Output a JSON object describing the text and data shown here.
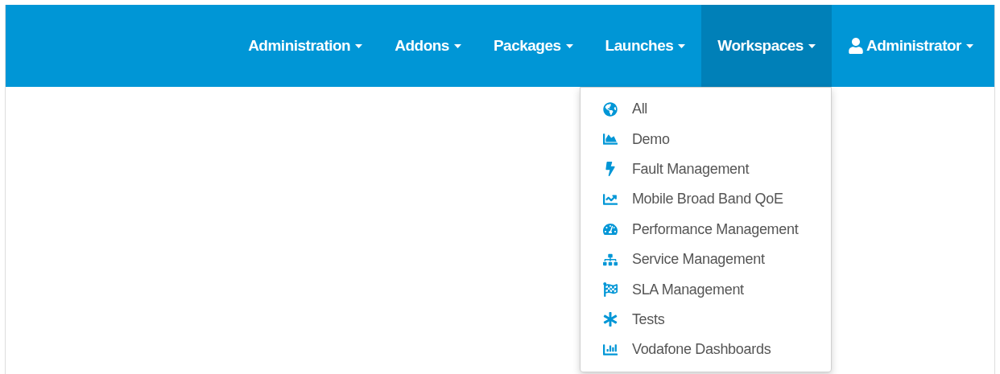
{
  "navbar": {
    "items": [
      {
        "label": "Administration",
        "selected": false
      },
      {
        "label": "Addons",
        "selected": false
      },
      {
        "label": "Packages",
        "selected": false
      },
      {
        "label": "Launches",
        "selected": false
      },
      {
        "label": "Workspaces",
        "selected": true
      },
      {
        "label": "Administrator",
        "selected": false
      }
    ]
  },
  "workspaces_menu": {
    "items": [
      "All",
      "Demo",
      "Fault Management",
      "Mobile Broad Band QoE",
      "Performance Management",
      "Service Management",
      "SLA Management",
      "Tests",
      "Vodafone Dashboards"
    ]
  }
}
